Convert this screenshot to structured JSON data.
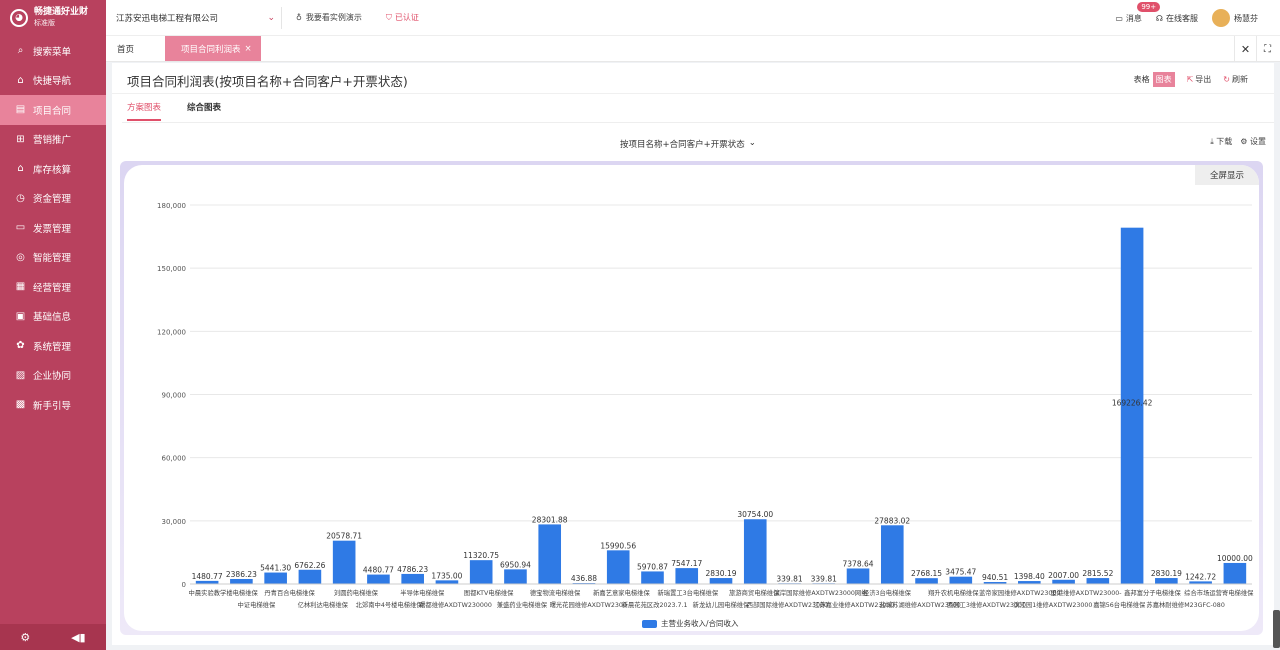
{
  "app": {
    "brand_name": "畅捷通好业财",
    "edition": "标准版",
    "brand_logo": "logo-icon"
  },
  "sidebar": {
    "items": [
      {
        "label": "搜索菜单",
        "icon": "search-menu-icon",
        "glyph": "⌕"
      },
      {
        "label": "快捷导航",
        "icon": "home-icon",
        "glyph": "⌂"
      },
      {
        "label": "项目合同",
        "icon": "contract-icon",
        "glyph": "▤",
        "active": true
      },
      {
        "label": "营销推广",
        "icon": "gift-icon",
        "glyph": "⊞"
      },
      {
        "label": "库存核算",
        "icon": "warehouse-icon",
        "glyph": "⌂"
      },
      {
        "label": "资金管理",
        "icon": "money-icon",
        "glyph": "◷"
      },
      {
        "label": "发票管理",
        "icon": "invoice-icon",
        "glyph": "▭"
      },
      {
        "label": "智能管理",
        "icon": "smart-icon",
        "glyph": "◎"
      },
      {
        "label": "经营管理",
        "icon": "business-icon",
        "glyph": "▦"
      },
      {
        "label": "基础信息",
        "icon": "info-icon",
        "glyph": "▣"
      },
      {
        "label": "系统管理",
        "icon": "settings-icon",
        "glyph": "✿"
      },
      {
        "label": "企业协同",
        "icon": "cooperate-icon",
        "glyph": "▨"
      },
      {
        "label": "新手引导",
        "icon": "guide-icon",
        "glyph": "▩"
      }
    ],
    "bottom_icons": [
      "gear-icon",
      "collapse-icon"
    ]
  },
  "topbar": {
    "company": "江苏安迅电梯工程有限公司",
    "demo_label": "我要看实例演示",
    "verified_label": "已认证",
    "message_label": "消息",
    "message_badge": "99+",
    "service_label": "在线客服",
    "user_name": "杨慧芬"
  },
  "tabs": {
    "home": "首页",
    "active": "项目合同利润表",
    "close_glyph": "×"
  },
  "page": {
    "title": "项目合同利润表(按项目名称+合同客户+开票状态)",
    "view_table": "表格",
    "view_chart": "图表",
    "export_label": "导出",
    "refresh_label": "刷新",
    "subtabs": [
      "方案图表",
      "综合图表"
    ],
    "group_by": "按项目名称+合同客户+开票状态",
    "download_label": "下载",
    "settings_label": "设置",
    "fullscreen_label": "全屏显示"
  },
  "chart_data": {
    "type": "bar",
    "ylim": [
      0,
      180000
    ],
    "yticks": [
      "0",
      "30,000",
      "60,000",
      "90,000",
      "120,000",
      "150,000",
      "180,000"
    ],
    "ytick_values": [
      0,
      30000,
      60000,
      90000,
      120000,
      150000,
      180000
    ],
    "legend": [
      {
        "name": "主营业务收入/合同收入",
        "color": "#2f7ae5"
      }
    ],
    "categories_row1": [
      "中晨实验教学楼电梯维保",
      "丹青百合电梯维保",
      "刘圆药电梯维保",
      "半导体电梯维保",
      "图都KTV电梯维保",
      "德宝物流电梯维保",
      "新嘉艺意家电梯维保",
      "新瑞置工3台电梯维保",
      "旅游商贸电梯维保",
      "滨岸国际维修AXDTW23000网络",
      "经济3台电梯维保",
      "翔升农机电梯维保",
      "蓝帝家园维修AXDTW23000",
      "里港维修AXDTW23000-",
      "鑫邦富分子电梯维保",
      "综合市场运营寄电梯维保"
    ],
    "categories_row2": [
      "中证电梯维保",
      "亿林利达电梯维保",
      "北郊南中4号楼电梯维保",
      "曙都维修AXDTW230000",
      "兼盛药业电梯维保",
      "曙光花园维修AXDTW2300",
      "新晨花苑区改2023.7.1",
      "新龙幼儿园电梯维保",
      "西部国际维修AXDTW23000",
      "江苏嘉业维修AXDTW23000",
      "盐城苏湖维修AXDTW23000",
      "西园工3维修AXDTW23000",
      "滨江园1维修AXDTW23000",
      "嘉锦56台电梯维保",
      "苏嘉林耐维修M23GFC-080"
    ],
    "values": [
      1480.77,
      2386.23,
      5441.3,
      6762.26,
      20578.71,
      4480.77,
      4786.23,
      1735.0,
      11320.75,
      6950.94,
      28301.88,
      436.88,
      15990.56,
      5970.87,
      7547.17,
      2830.19,
      30754.0,
      339.81,
      339.81,
      7378.64,
      27883.02,
      2768.15,
      3475.47,
      940.51,
      1398.4,
      2007.0,
      2815.52,
      169226.42,
      2830.19,
      1242.72,
      10000.0
    ],
    "labels": [
      "1480.77",
      "2386.23",
      "5441.30",
      "6762.26",
      "20578.71",
      "4480.77",
      "4786.23",
      "1735.00",
      "11320.75",
      "6950.94",
      "28301.88",
      "436.88",
      "15990.56",
      "5970.87",
      "7547.17",
      "2830.19",
      "30754.00",
      "339.81",
      "339.81",
      "7378.64",
      "27883.02",
      "2768.15",
      "3475.47",
      "940.51",
      "1398.40",
      "2007.00",
      "2815.52",
      "169226.42",
      "2830.19",
      "1242.72",
      "10000.00"
    ],
    "grid": true,
    "legend_position": "bottom-center"
  }
}
